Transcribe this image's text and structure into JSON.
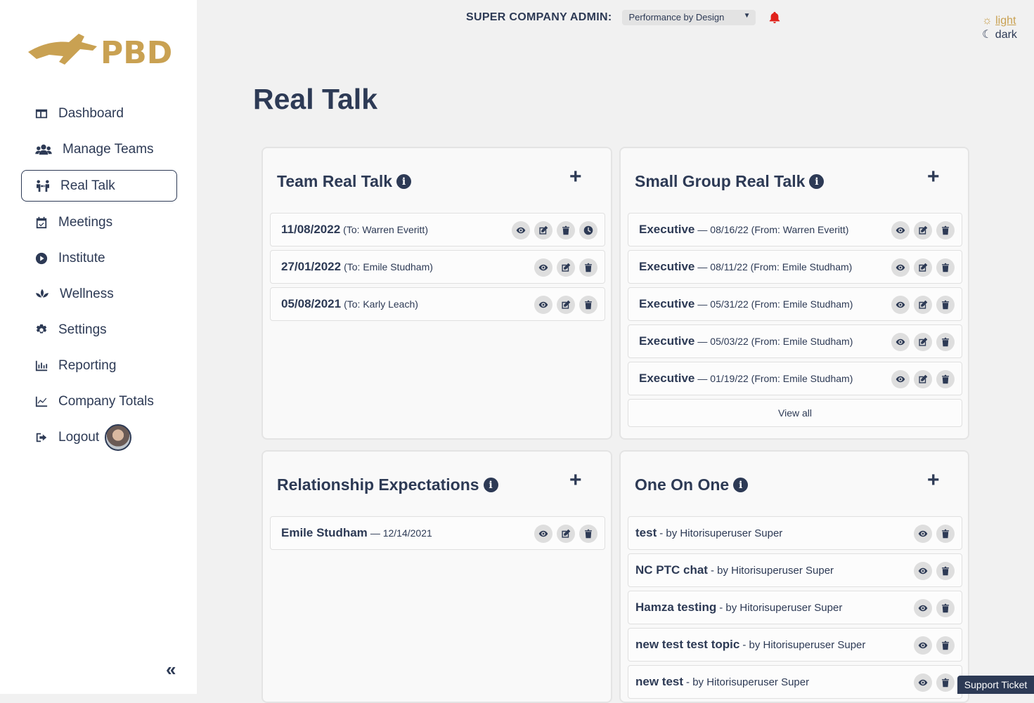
{
  "logo": {
    "text": "PBD"
  },
  "sidebar": {
    "items": [
      {
        "label": "Dashboard",
        "icon": "dashboard-icon"
      },
      {
        "label": "Manage Teams",
        "icon": "users-icon"
      },
      {
        "label": "Real Talk",
        "icon": "people-arrows-icon",
        "active": true
      },
      {
        "label": "Meetings",
        "icon": "calendar-check-icon"
      },
      {
        "label": "Institute",
        "icon": "play-circle-icon"
      },
      {
        "label": "Wellness",
        "icon": "lotus-icon"
      },
      {
        "label": "Settings",
        "icon": "gear-icon"
      },
      {
        "label": "Reporting",
        "icon": "bar-chart-icon"
      },
      {
        "label": "Company Totals",
        "icon": "line-chart-icon"
      },
      {
        "label": "Logout",
        "icon": "sign-out-icon"
      }
    ],
    "collapse_label": "«"
  },
  "header": {
    "admin_label": "SUPER COMPANY ADMIN:",
    "company_selected": "Performance by Design",
    "theme_light": "light",
    "theme_dark": "dark"
  },
  "page": {
    "title": "Real Talk"
  },
  "team_real_talk": {
    "title": "Team Real Talk",
    "rows": [
      {
        "date": "11/08/2022",
        "detail": "(To: Warren Everitt)",
        "actions": [
          "view",
          "edit",
          "delete",
          "clock"
        ]
      },
      {
        "date": "27/01/2022",
        "detail": "(To: Emile Studham)",
        "actions": [
          "view",
          "edit",
          "delete"
        ]
      },
      {
        "date": "05/08/2021",
        "detail": "(To: Karly Leach)",
        "actions": [
          "view",
          "edit",
          "delete"
        ]
      }
    ]
  },
  "small_group": {
    "title": "Small Group Real Talk",
    "rows": [
      {
        "name": "Executive",
        "detail": "— 08/16/22 (From: Warren Everitt)"
      },
      {
        "name": "Executive",
        "detail": "— 08/11/22 (From: Emile Studham)"
      },
      {
        "name": "Executive",
        "detail": "— 05/31/22 (From: Emile Studham)"
      },
      {
        "name": "Executive",
        "detail": "— 05/03/22 (From: Emile Studham)"
      },
      {
        "name": "Executive",
        "detail": "— 01/19/22 (From: Emile Studham)"
      }
    ],
    "view_all": "View all"
  },
  "relationship": {
    "title": "Relationship Expectations",
    "rows": [
      {
        "name": "Emile Studham",
        "detail": "— 12/14/2021"
      }
    ]
  },
  "one_on_one": {
    "title": "One On One",
    "rows": [
      {
        "name": "test",
        "detail": "- by Hitorisuperuser Super"
      },
      {
        "name": "NC PTC chat",
        "detail": "- by Hitorisuperuser Super"
      },
      {
        "name": "Hamza testing",
        "detail": "- by Hitorisuperuser Super"
      },
      {
        "name": "new test test topic",
        "detail": "- by Hitorisuperuser Super"
      },
      {
        "name": "new test",
        "detail": "- by Hitorisuperuser Super"
      }
    ]
  },
  "support": {
    "label": "Support Ticket"
  },
  "colors": {
    "brand_gold": "#c9a152",
    "navy": "#2d3a55",
    "alert_red": "#e0221b"
  }
}
